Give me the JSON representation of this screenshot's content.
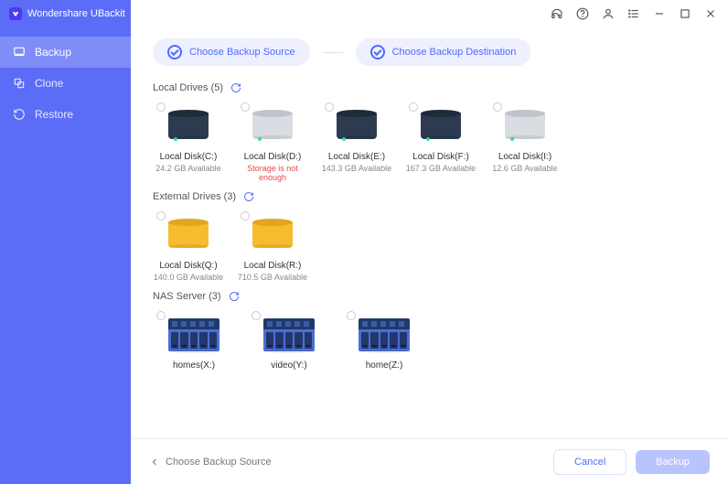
{
  "app": {
    "title": "Wondershare UBackit"
  },
  "sidebar": {
    "items": [
      {
        "label": "Backup",
        "active": true
      },
      {
        "label": "Clone",
        "active": false
      },
      {
        "label": "Restore",
        "active": false
      }
    ]
  },
  "steps": {
    "source": "Choose Backup Source",
    "destination": "Choose Backup Destination"
  },
  "sections": {
    "local": {
      "title": "Local Drives (5)"
    },
    "external": {
      "title": "External Drives (3)"
    },
    "nas": {
      "title": "NAS Server (3)"
    }
  },
  "drives": {
    "local": [
      {
        "name": "Local Disk(C:)",
        "sub": "24.2 GB Available",
        "style": "dark",
        "err": false
      },
      {
        "name": "Local Disk(D:)",
        "sub": "Storage is not enough",
        "style": "light",
        "err": true
      },
      {
        "name": "Local Disk(E:)",
        "sub": "143.3 GB Available",
        "style": "dark",
        "err": false
      },
      {
        "name": "Local Disk(F:)",
        "sub": "167.3 GB Available",
        "style": "dark",
        "err": false
      },
      {
        "name": "Local Disk(I:)",
        "sub": "12.6 GB Available",
        "style": "light",
        "err": false
      }
    ],
    "external": [
      {
        "name": "Local Disk(Q:)",
        "sub": "140.0 GB Available"
      },
      {
        "name": "Local Disk(R:)",
        "sub": "710.5 GB Available"
      }
    ],
    "nas": [
      {
        "name": "homes(X:)"
      },
      {
        "name": "video(Y:)"
      },
      {
        "name": "home(Z:)"
      }
    ]
  },
  "footer": {
    "back": "Choose Backup Source",
    "cancel": "Cancel",
    "primary": "Backup"
  }
}
